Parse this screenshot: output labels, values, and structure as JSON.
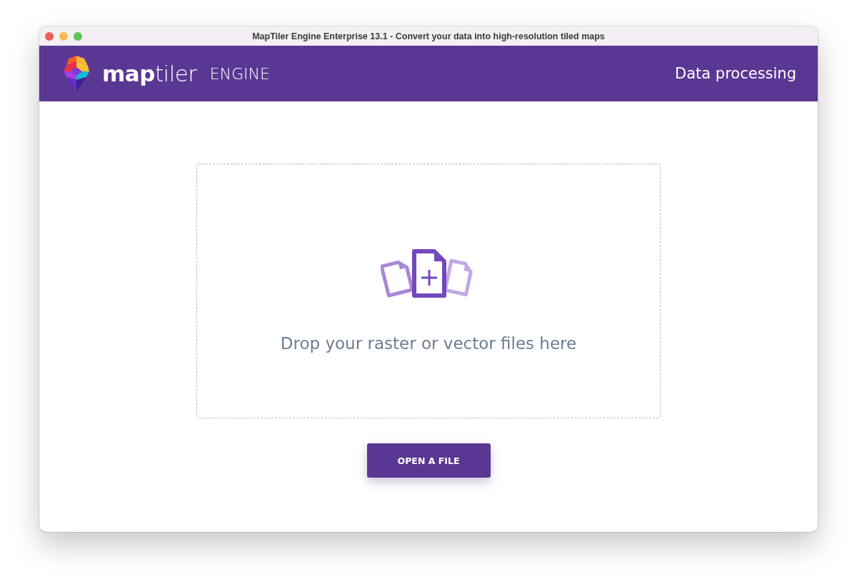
{
  "window": {
    "title": "MapTiler Engine Enterprise 13.1 - Convert your data into high-resolution tiled maps"
  },
  "header": {
    "logo_text": "**map**tiler",
    "logo_suffix": "ENGINE",
    "section": "Data processing"
  },
  "dropzone": {
    "message": "Drop your raster or vector files here"
  },
  "buttons": [
    {
      "label": "OPEN A FILE"
    }
  ]
}
